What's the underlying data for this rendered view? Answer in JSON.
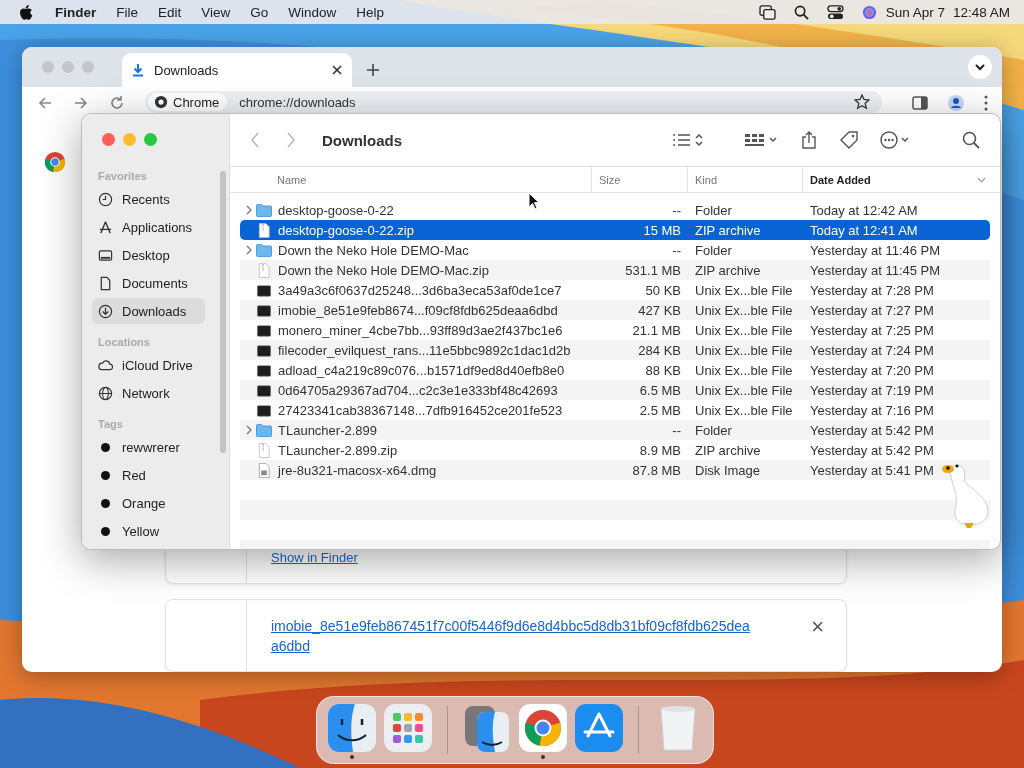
{
  "menu_bar": {
    "app": "Finder",
    "menus": [
      "File",
      "Edit",
      "View",
      "Go",
      "Window",
      "Help"
    ],
    "date": "Sun Apr 7",
    "time": "12:48 AM"
  },
  "browser": {
    "tab": {
      "title": "Downloads"
    },
    "address": {
      "chip": "Chrome",
      "url": "chrome://downloads"
    },
    "downloads": [
      {
        "kind": "action",
        "text": "Show in Finder"
      },
      {
        "kind": "file",
        "text": "imobie_8e51e9feb867451f7c00f5446f9d6e8d4bbc5d8db31bf09cf8fdb625deaa6dbd",
        "close": "×"
      }
    ]
  },
  "finder": {
    "title": "Downloads",
    "sidebar": [
      {
        "heading": "Favorites",
        "items": [
          {
            "label": "Recents",
            "kind": "clock",
            "selected": false
          },
          {
            "label": "Applications",
            "kind": "apps",
            "selected": false
          },
          {
            "label": "Desktop",
            "kind": "desktop",
            "selected": false
          },
          {
            "label": "Documents",
            "kind": "document",
            "selected": false
          },
          {
            "label": "Downloads",
            "kind": "download",
            "selected": true
          }
        ]
      },
      {
        "heading": "Locations",
        "items": [
          {
            "label": "iCloud Drive",
            "kind": "cloud",
            "selected": false
          },
          {
            "label": "Network",
            "kind": "globe",
            "selected": false
          }
        ]
      },
      {
        "heading": "Tags",
        "items": [
          {
            "label": "rewwrerer",
            "kind": "tag",
            "selected": false
          },
          {
            "label": "Red",
            "kind": "tag",
            "selected": false
          },
          {
            "label": "Orange",
            "kind": "tag",
            "selected": false
          },
          {
            "label": "Yellow",
            "kind": "tag",
            "selected": false
          }
        ]
      }
    ],
    "columns": [
      {
        "label": "Name",
        "sorted": false
      },
      {
        "label": "Size",
        "sorted": false
      },
      {
        "label": "Kind",
        "sorted": false
      },
      {
        "label": "Date Added",
        "sorted": true
      }
    ],
    "rows": [
      {
        "name": "desktop-goose-0-22",
        "size": "--",
        "kind_text": "Folder",
        "date": "Today at 12:42 AM",
        "kind": "folder",
        "selected": false
      },
      {
        "name": "desktop-goose-0-22.zip",
        "size": "15 MB",
        "kind_text": "ZIP archive",
        "date": "Today at 12:41 AM",
        "kind": "zip",
        "selected": true
      },
      {
        "name": "Down the Neko Hole DEMO-Mac",
        "size": "--",
        "kind_text": "Folder",
        "date": "Yesterday at 11:46 PM",
        "kind": "folder",
        "selected": false
      },
      {
        "name": "Down the Neko Hole DEMO-Mac.zip",
        "size": "531.1 MB",
        "kind_text": "ZIP archive",
        "date": "Yesterday at 11:45 PM",
        "kind": "zip",
        "selected": false
      },
      {
        "name": "3a49a3c6f0637d25248...3d6ba3eca53af0de1ce7",
        "size": "50 KB",
        "kind_text": "Unix Ex...ble File",
        "date": "Yesterday at 7:28 PM",
        "kind": "exec",
        "selected": false
      },
      {
        "name": "imobie_8e51e9feb8674...f09cf8fdb625deaa6dbd",
        "size": "427 KB",
        "kind_text": "Unix Ex...ble File",
        "date": "Yesterday at 7:27 PM",
        "kind": "exec",
        "selected": false
      },
      {
        "name": "monero_miner_4cbe7bb...93ff89d3ae2f437bc1e6",
        "size": "21.1 MB",
        "kind_text": "Unix Ex...ble File",
        "date": "Yesterday at 7:25 PM",
        "kind": "exec",
        "selected": false
      },
      {
        "name": "filecoder_evilquest_rans...11e5bbc9892c1dac1d2b",
        "size": "284 KB",
        "kind_text": "Unix Ex...ble File",
        "date": "Yesterday at 7:24 PM",
        "kind": "exec",
        "selected": false
      },
      {
        "name": "adload_c4a219c89c076...b1571df9ed8d40efb8e0",
        "size": "88 KB",
        "kind_text": "Unix Ex...ble File",
        "date": "Yesterday at 7:20 PM",
        "kind": "exec",
        "selected": false
      },
      {
        "name": "0d64705a29367ad704...c2c3e1e333bf48c42693",
        "size": "6.5 MB",
        "kind_text": "Unix Ex...ble File",
        "date": "Yesterday at 7:19 PM",
        "kind": "exec",
        "selected": false
      },
      {
        "name": "27423341cab38367148...7dfb916452ce201fe523",
        "size": "2.5 MB",
        "kind_text": "Unix Ex...ble File",
        "date": "Yesterday at 7:16 PM",
        "kind": "exec",
        "selected": false
      },
      {
        "name": "TLauncher-2.899",
        "size": "--",
        "kind_text": "Folder",
        "date": "Yesterday at 5:42 PM",
        "kind": "folder",
        "selected": false
      },
      {
        "name": "TLauncher-2.899.zip",
        "size": "8.9 MB",
        "kind_text": "ZIP archive",
        "date": "Yesterday at 5:42 PM",
        "kind": "zip",
        "selected": false
      },
      {
        "name": "jre-8u321-macosx-x64.dmg",
        "size": "87.8 MB",
        "kind_text": "Disk Image",
        "date": "Yesterday at 5:41 PM",
        "kind": "dmg",
        "selected": false
      }
    ]
  },
  "dock": [
    {
      "kind": "finder",
      "running": true
    },
    {
      "kind": "launchpad",
      "running": false
    },
    {
      "kind": "divider"
    },
    {
      "kind": "migration",
      "running": false
    },
    {
      "kind": "chrome",
      "running": true
    },
    {
      "kind": "appstore",
      "running": false
    },
    {
      "kind": "divider"
    },
    {
      "kind": "trash",
      "running": false
    }
  ]
}
